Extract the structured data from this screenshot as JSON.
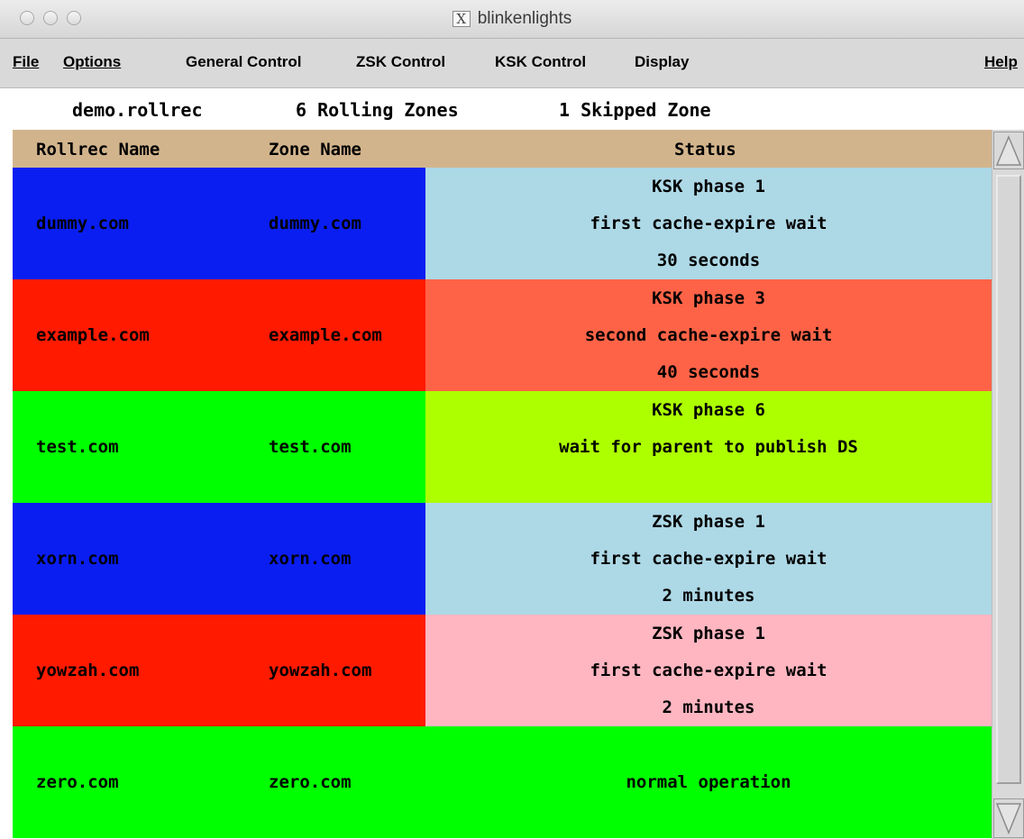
{
  "window": {
    "title": "blinkenlights",
    "title_icon": "X"
  },
  "menu": {
    "file": "File",
    "options": "Options",
    "general_control": "General Control",
    "zsk_control": "ZSK Control",
    "ksk_control": "KSK Control",
    "display": "Display",
    "help": "Help"
  },
  "summary": {
    "rollrec_file": "demo.rollrec",
    "rolling_zones": "6 Rolling Zones",
    "skipped_zones": "1 Skipped Zone"
  },
  "table": {
    "headers": {
      "rollrec_name": "Rollrec Name",
      "zone_name": "Zone Name",
      "status": "Status"
    },
    "rows": [
      {
        "rollrec_name": "dummy.com",
        "zone_name": "dummy.com",
        "status": [
          "KSK phase 1",
          "first cache-expire wait",
          "30 seconds"
        ],
        "name_color": "#0a1ef2",
        "status_color": "#add8e6"
      },
      {
        "rollrec_name": "example.com",
        "zone_name": "example.com",
        "status": [
          "KSK phase 3",
          "second cache-expire wait",
          "40 seconds"
        ],
        "name_color": "#ff1a00",
        "status_color": "#ff6347"
      },
      {
        "rollrec_name": "test.com",
        "zone_name": "test.com",
        "status": [
          "KSK phase 6",
          "wait for parent to publish DS"
        ],
        "name_color": "#00ff00",
        "status_color": "#adff00"
      },
      {
        "rollrec_name": "xorn.com",
        "zone_name": "xorn.com",
        "status": [
          "ZSK phase 1",
          "first cache-expire wait",
          "2 minutes"
        ],
        "name_color": "#0a1ef2",
        "status_color": "#add8e6"
      },
      {
        "rollrec_name": "yowzah.com",
        "zone_name": "yowzah.com",
        "status": [
          "ZSK phase 1",
          "first cache-expire wait",
          "2 minutes"
        ],
        "name_color": "#ff1a00",
        "status_color": "#ffb6c1"
      },
      {
        "rollrec_name": "zero.com",
        "zone_name": "zero.com",
        "status": [
          "normal operation"
        ],
        "name_color": "#00ff00",
        "status_color": "#00ff00"
      }
    ]
  },
  "colors": {
    "header_bg": "#d2b48c",
    "menubar_bg": "#d9d9d9"
  },
  "icons": {
    "window_close": "close-icon",
    "window_minimize": "minimize-icon",
    "window_zoom": "zoom-icon",
    "x11": "x11-icon",
    "scroll_up": "scroll-up-arrow-icon",
    "scroll_down": "scroll-down-arrow-icon"
  }
}
